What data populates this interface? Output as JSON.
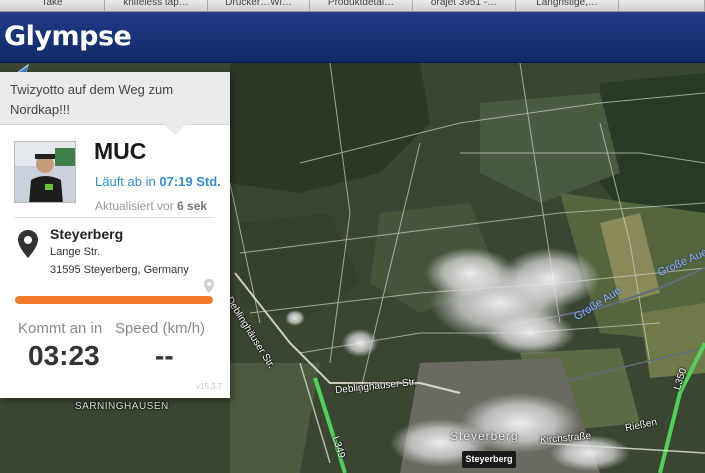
{
  "browser": {
    "bookmark_tabs": [
      "Take",
      "knifeless tap…",
      "Drucker…Wi…",
      "Produktdetai…",
      "orajet 3951 -…",
      "Langristige,…"
    ]
  },
  "header": {
    "logo": "Glympse"
  },
  "panel": {
    "message": "Twizyotto auf dem Weg zum Nordkap!!!",
    "code": "MUC",
    "expires_prefix": "Läuft ab in ",
    "expires_value": "07:19 Std.",
    "updated_prefix": "Aktualisiert vor ",
    "updated_value": "6 sek",
    "destination": {
      "name": "Steyerberg",
      "street": "Lange Str.",
      "city": "31595 Steyerberg, Germany"
    },
    "progress": 1.0,
    "arrive_label": "Kommt an in",
    "speed_label": "Speed (km/h)",
    "arrive_value": "03:23",
    "speed_value": "--",
    "version": "v15.3.7"
  },
  "map": {
    "labels": {
      "road_deblinghauser_1": "Deblinghäuser Str.",
      "road_deblinghauser_2": "Deblinghäuser Str.",
      "grosse_aue_1": "Große Aue",
      "grosse_aue_2": "Große Aue",
      "sarninghausen": "SARNINGHAUSEN",
      "town": "Steyerberg",
      "pin": "Steyerberg",
      "kirchstrasse": "Kirchstraße",
      "riessen": "Rießen",
      "l349": "L349",
      "l350": "L350"
    }
  },
  "colors": {
    "header": "#1f3a86",
    "logo_accent": "#ff8a1a",
    "link_blue": "#2f8fd6",
    "progress": "#f27a2a"
  }
}
